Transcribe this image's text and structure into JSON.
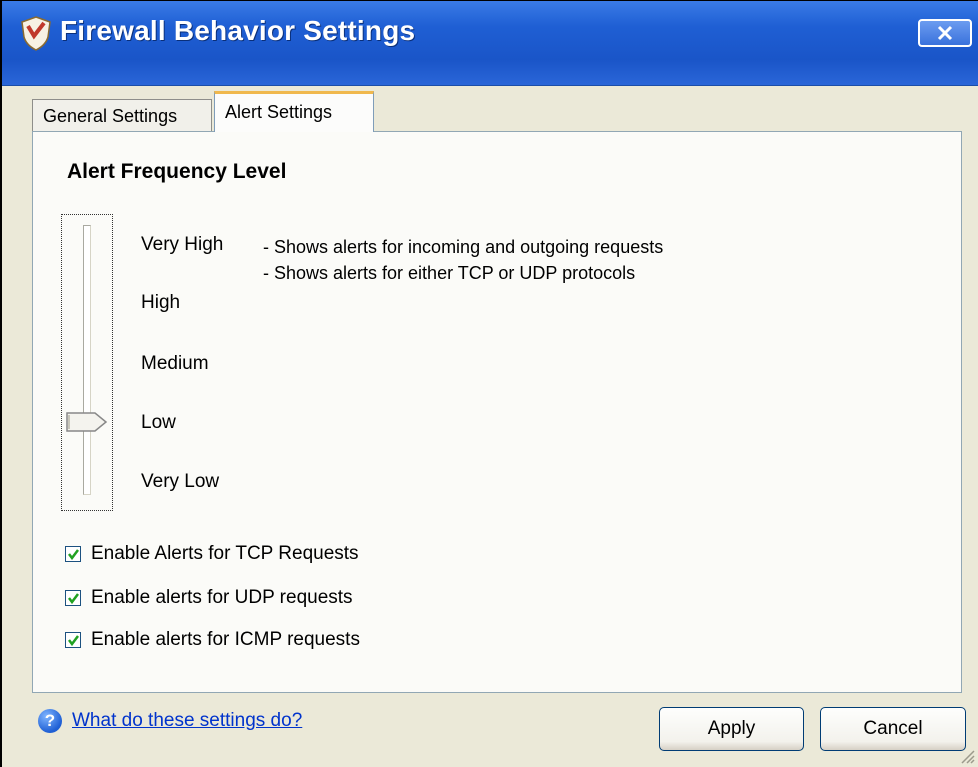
{
  "window": {
    "title": "Firewall Behavior Settings"
  },
  "tabs": [
    {
      "label": "General Settings",
      "active": false
    },
    {
      "label": "Alert Settings",
      "active": true
    }
  ],
  "alerts": {
    "group_title": "Alert Frequency Level",
    "levels": [
      "Very High",
      "High",
      "Medium",
      "Low",
      "Very Low"
    ],
    "selected_level": "Low",
    "description": [
      "- Shows alerts for incoming and outgoing requests",
      "- Shows alerts for either TCP or UDP protocols"
    ],
    "checkboxes": [
      {
        "label": "Enable Alerts for TCP Requests",
        "checked": true
      },
      {
        "label": "Enable alerts for UDP requests",
        "checked": true
      },
      {
        "label": "Enable alerts for ICMP requests",
        "checked": true
      }
    ]
  },
  "footer": {
    "help_link": "What do these settings do?",
    "apply_label": "Apply",
    "cancel_label": "Cancel"
  },
  "colors": {
    "titlebar": "#1f5fd4",
    "check": "#21a121",
    "link": "#0033cc"
  }
}
